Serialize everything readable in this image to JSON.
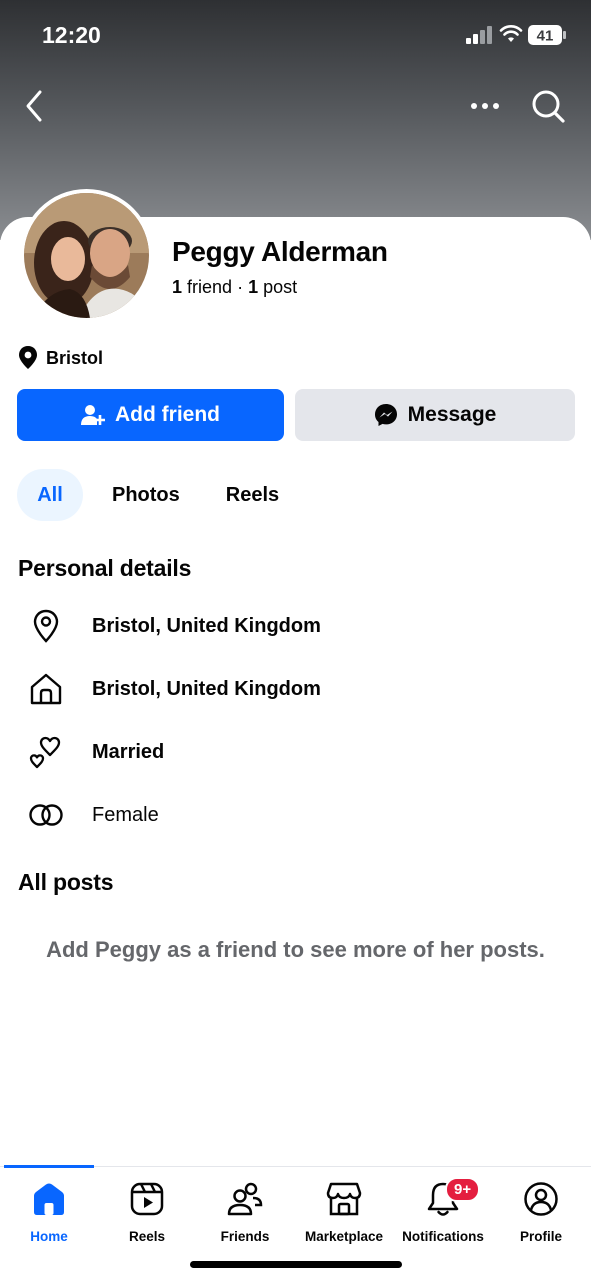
{
  "status_bar": {
    "time": "12:20",
    "battery": "41"
  },
  "profile": {
    "name": "Peggy Alderman",
    "friends_count": "1",
    "friends_label": "friend",
    "separator": "·",
    "posts_count": "1",
    "posts_label": "post",
    "location": "Bristol"
  },
  "actions": {
    "add_friend": "Add friend",
    "message": "Message"
  },
  "tabs": [
    {
      "label": "All"
    },
    {
      "label": "Photos"
    },
    {
      "label": "Reels"
    }
  ],
  "personal_details": {
    "title": "Personal details",
    "items": [
      {
        "icon": "location-pin-icon",
        "text": "Bristol, United Kingdom"
      },
      {
        "icon": "home-icon",
        "text": "Bristol, United Kingdom"
      },
      {
        "icon": "hearts-icon",
        "text": "Married"
      },
      {
        "icon": "gender-icon",
        "text": "Female"
      }
    ]
  },
  "all_posts": {
    "title": "All posts",
    "message": "Add Peggy as a friend to see more of her posts."
  },
  "bottom_nav": {
    "items": [
      {
        "label": "Home",
        "icon": "home-icon"
      },
      {
        "label": "Reels",
        "icon": "reels-icon"
      },
      {
        "label": "Friends",
        "icon": "friends-icon"
      },
      {
        "label": "Marketplace",
        "icon": "marketplace-icon"
      },
      {
        "label": "Notifications",
        "icon": "bell-icon"
      },
      {
        "label": "Profile",
        "icon": "profile-icon"
      }
    ],
    "notifications_badge": "9+"
  },
  "colors": {
    "accent": "#0866ff",
    "secondary_button": "#e4e6eb",
    "muted_text": "#65676b",
    "badge": "#e41e3f"
  }
}
